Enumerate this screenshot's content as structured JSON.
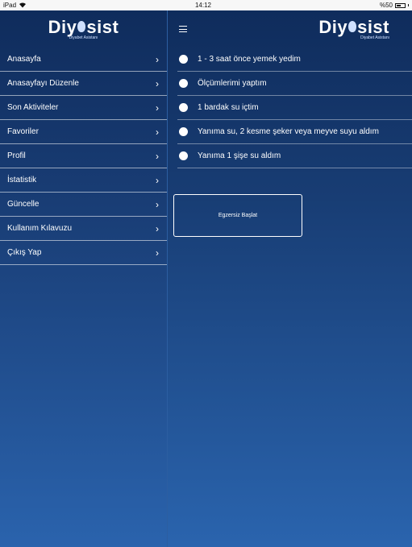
{
  "status": {
    "device": "iPad",
    "wifi_icon": "wifi-icon",
    "time": "14:12",
    "battery": "%50",
    "battery_level": 0.5
  },
  "brand": {
    "logo_text_left": "Diy",
    "logo_text_right": "sist",
    "logo_subtitle": "Diyabet Asistanı",
    "logo_icon": "apple-icon",
    "color_bg_top": "#0f2c5c",
    "color_bg_bottom": "#2a63ad"
  },
  "sidebar": {
    "items": [
      {
        "label": "Anasayfa"
      },
      {
        "label": "Anasayfayı Düzenle"
      },
      {
        "label": "Son Aktiviteler"
      },
      {
        "label": "Favoriler"
      },
      {
        "label": "Profil"
      },
      {
        "label": "İstatistik"
      },
      {
        "label": "Güncelle"
      },
      {
        "label": "Kullanım Kılavuzu"
      },
      {
        "label": "Çıkış Yap"
      }
    ],
    "chevron": "›"
  },
  "main": {
    "menu_icon": "hamburger-icon",
    "options": [
      {
        "label": "1 - 3 saat önce yemek yedim"
      },
      {
        "label": "Ölçümlerimi yaptım"
      },
      {
        "label": "1 bardak su içtim"
      },
      {
        "label": "Yanıma su, 2 kesme şeker veya meyve suyu aldım"
      },
      {
        "label": "Yanıma 1 şişe su aldım"
      }
    ],
    "start_button": "Egzersiz Başlat"
  }
}
